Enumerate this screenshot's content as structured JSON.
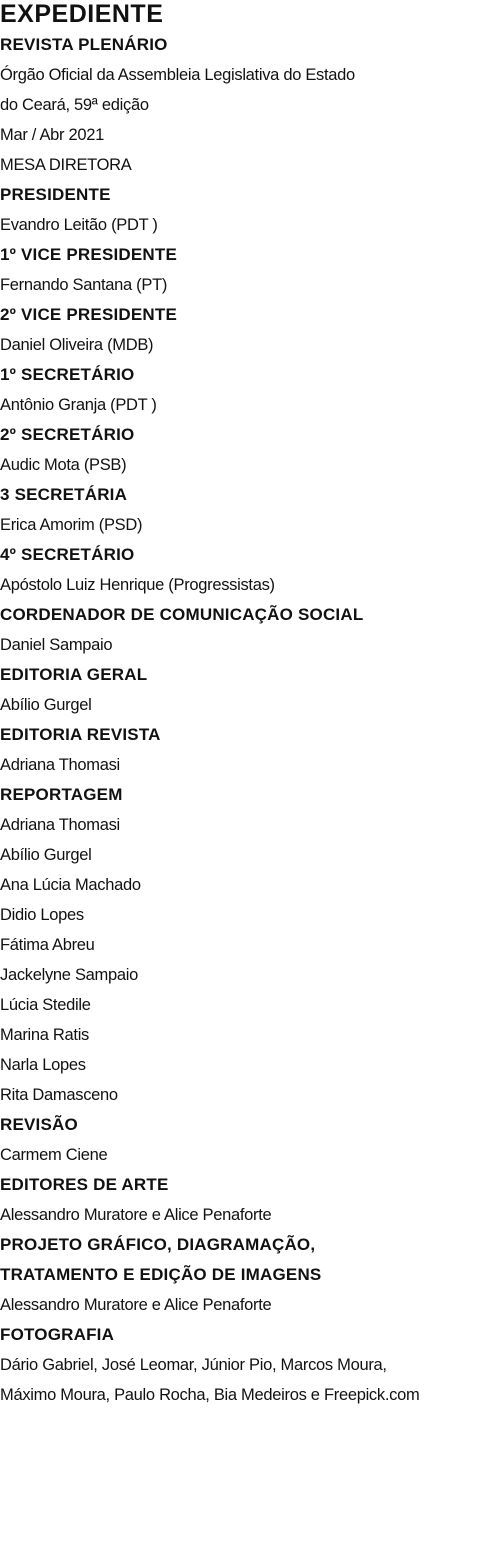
{
  "masthead": {
    "title": "EXPEDIENTE",
    "lines": [
      {
        "style": "heading",
        "text": "REVISTA PLENÁRIO"
      },
      {
        "style": "text",
        "text": "Órgão Oficial da Assembleia Legislativa do Estado"
      },
      {
        "style": "text",
        "text": "do Ceará, 59ª edição"
      },
      {
        "style": "text",
        "text": "Mar / Abr 2021"
      },
      {
        "style": "text",
        "text": "MESA DIRETORA"
      },
      {
        "style": "heading",
        "text": "PRESIDENTE"
      },
      {
        "style": "text",
        "text": "Evandro Leitão (PDT )"
      },
      {
        "style": "heading",
        "text": "1º VICE PRESIDENTE"
      },
      {
        "style": "text",
        "text": "Fernando Santana (PT)"
      },
      {
        "style": "heading",
        "text": "2º VICE PRESIDENTE"
      },
      {
        "style": "text",
        "text": "Daniel Oliveira (MDB)"
      },
      {
        "style": "heading",
        "text": "1º SECRETÁRIO"
      },
      {
        "style": "text",
        "text": "Antônio Granja (PDT )"
      },
      {
        "style": "heading",
        "text": "2º SECRETÁRIO"
      },
      {
        "style": "text",
        "text": "Audic Mota (PSB)"
      },
      {
        "style": "heading",
        "text": "3 SECRETÁRIA"
      },
      {
        "style": "text",
        "text": "Erica Amorim (PSD)"
      },
      {
        "style": "heading",
        "text": "4º SECRETÁRIO"
      },
      {
        "style": "text",
        "text": "Apóstolo Luiz Henrique (Progressistas)"
      },
      {
        "style": "heading",
        "text": "CORDENADOR DE COMUNICAÇÃO SOCIAL"
      },
      {
        "style": "light",
        "text": "Daniel Sampaio"
      },
      {
        "style": "heading",
        "text": "EDITORIA GERAL"
      },
      {
        "style": "light",
        "text": "Abílio Gurgel"
      },
      {
        "style": "heading",
        "text": "EDITORIA REVISTA"
      },
      {
        "style": "light",
        "text": "Adriana Thomasi"
      },
      {
        "style": "heading",
        "text": "REPORTAGEM"
      },
      {
        "style": "light",
        "text": "Adriana Thomasi"
      },
      {
        "style": "light",
        "text": "Abílio Gurgel"
      },
      {
        "style": "light",
        "text": "Ana Lúcia Machado"
      },
      {
        "style": "light",
        "text": "Didio Lopes"
      },
      {
        "style": "light",
        "text": "Fátima Abreu"
      },
      {
        "style": "light",
        "text": "Jackelyne Sampaio"
      },
      {
        "style": "light",
        "text": "Lúcia Stedile"
      },
      {
        "style": "light",
        "text": "Marina Ratis"
      },
      {
        "style": "light",
        "text": "Narla Lopes"
      },
      {
        "style": "light",
        "text": "Rita Damasceno"
      },
      {
        "style": "heading",
        "text": "REVISÃO"
      },
      {
        "style": "light",
        "text": "Carmem Ciene"
      },
      {
        "style": "heading",
        "text": "EDITORES DE ARTE"
      },
      {
        "style": "light",
        "text": "Alessandro Muratore e Alice Penaforte"
      },
      {
        "style": "heading",
        "text": "PROJETO GRÁFICO, DIAGRAMAÇÃO,"
      },
      {
        "style": "heading",
        "text": "TRATAMENTO E EDIÇÃO DE IMAGENS"
      },
      {
        "style": "light",
        "text": "Alessandro Muratore e Alice Penaforte"
      },
      {
        "style": "heading",
        "text": "FOTOGRAFIA"
      },
      {
        "style": "light",
        "text": "Dário Gabriel, José Leomar, Júnior Pio, Marcos Moura,"
      },
      {
        "style": "light",
        "text": "Máximo Moura, Paulo Rocha, Bia Medeiros e Freepick.com"
      }
    ]
  }
}
